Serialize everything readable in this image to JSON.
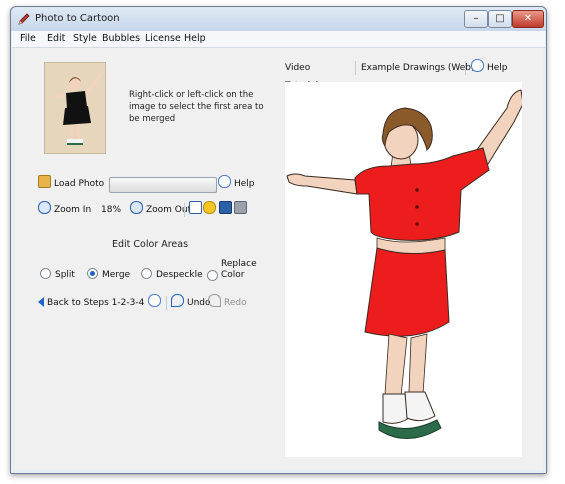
{
  "window": {
    "title": "Photo to Cartoon"
  },
  "title_buttons": {
    "minimize": "–",
    "maximize": "□",
    "close": "✕"
  },
  "menu": [
    "File",
    "Edit",
    "Style",
    "Bubbles",
    "License",
    "Help"
  ],
  "instruction": "Right-click or left-click on the image to select the first area to be merged",
  "toolbar1": {
    "load_photo": "Load Photo",
    "help": "Help"
  },
  "toolbar2": {
    "zoom_in": "Zoom In",
    "zoom_level": "18%",
    "zoom_out": "Zoom Out"
  },
  "edit_heading": "Edit Color Areas",
  "modes": [
    {
      "label": "Split",
      "selected": false
    },
    {
      "label": "Merge",
      "selected": true
    },
    {
      "label": "Despeckle",
      "selected": false
    },
    {
      "label": "Replace Color",
      "selected": false
    }
  ],
  "toolbar3": {
    "back": "Back to Steps 1-2-3-4",
    "undo": "Undo",
    "redo": "Redo"
  },
  "tabs": {
    "video": "Video Tutorial",
    "examples": "Example Drawings (Web)",
    "help": "Help"
  },
  "icons": {
    "app": "pencil-icon",
    "load": "folder-icon",
    "help": "help-bubble-icon",
    "zoom_in": "zoom-in-icon",
    "zoom_out": "zoom-out-icon",
    "checkbox": "checkbox-icon",
    "face": "smiley-icon",
    "save": "save-icon",
    "print": "printer-icon",
    "back": "back-arrow-icon",
    "undo": "undo-icon",
    "redo": "redo-icon"
  },
  "colors": {
    "dress": "#ee1d1d",
    "skin": "#f2d3bd",
    "hair": "#8b5a2b",
    "accent": "#1f63c6"
  }
}
